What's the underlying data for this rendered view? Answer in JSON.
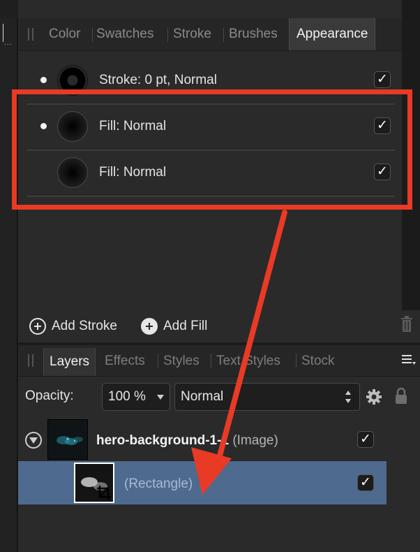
{
  "panel_tabs": [
    "Color",
    "Swatches",
    "Stroke",
    "Brushes",
    "Appearance"
  ],
  "active_panel_tab": "Appearance",
  "appearance_rows": [
    {
      "label": "Stroke: 0 pt, Normal",
      "checked": "✓"
    },
    {
      "label": "Fill: Normal",
      "checked": "✓"
    },
    {
      "label": "Fill: Normal",
      "checked": "✓"
    }
  ],
  "buttons": {
    "add_stroke": "Add Stroke",
    "add_fill": "Add Fill"
  },
  "layers_tabs": [
    "Layers",
    "Effects",
    "Styles",
    "Text Styles",
    "Stock"
  ],
  "active_layers_tab": "Layers",
  "opacity": {
    "label": "Opacity:",
    "value": "100 %",
    "blend_mode": "Normal"
  },
  "layers": [
    {
      "name": "hero-background-1-1",
      "type": "(Image)",
      "checked": "✓"
    },
    {
      "name": "",
      "type": "(Rectangle)",
      "checked": "✓"
    }
  ],
  "colors": {
    "annotation": "#e93a25",
    "selected_row": "#4e6a8e"
  },
  "icons": [
    "expand-triangle-icon",
    "gear-icon",
    "lock-icon",
    "trash-icon",
    "panel-menu-icon",
    "plus-circle-icon",
    "crop-icon"
  ]
}
